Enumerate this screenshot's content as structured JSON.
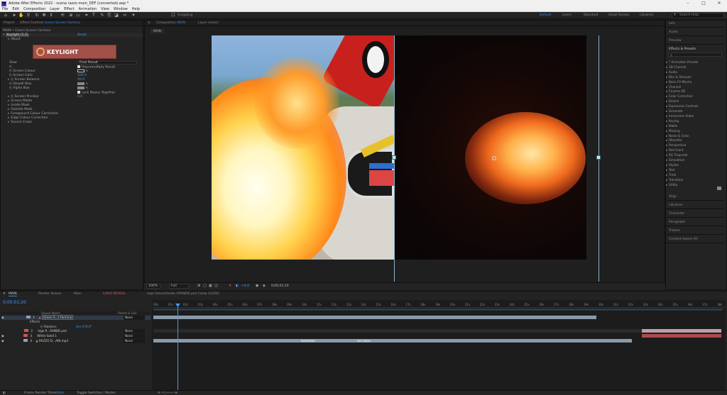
{
  "window": {
    "title": "Adobe After Effects 2022 - scena razzo main_DEF (converted).aep *",
    "app_badge": "Ae"
  },
  "window_controls": {
    "minimize": "–",
    "maximize": "□",
    "close": "✕"
  },
  "menu": [
    "File",
    "Edit",
    "Composition",
    "Layer",
    "Effect",
    "Animation",
    "View",
    "Window",
    "Help"
  ],
  "toolbar": {
    "snapping": "Snapping",
    "workspaces": [
      "Default",
      "Learn",
      "Standard",
      "Small Screen",
      "Libraries"
    ],
    "active_workspace": "Default",
    "search_placeholder": "Search Help",
    "tools": [
      "home-icon",
      "selection-icon",
      "hand-icon",
      "zoom-icon",
      "orbit-icon",
      "pan-icon",
      "dolly-icon",
      "rotate-icon",
      "anchor-icon",
      "pen-icon",
      "type-icon",
      "brush-icon",
      "clone-icon",
      "eraser-icon",
      "roto-icon",
      "puppet-icon"
    ]
  },
  "left_panel": {
    "tabs": [
      "Project",
      "Effect Controls Green Screen Farmina"
    ],
    "tab_effect_controls": "Effect Controls",
    "tab_layer_name": "Green Screen Farmina",
    "path": "MAIN • Green Screen Farmina",
    "effect_name": "Keylight (1.2)",
    "reset": "Reset",
    "about": "About",
    "logo_text": "KEYLIGHT",
    "rows": [
      {
        "label": "View",
        "value": "Final Result"
      },
      {
        "label": "",
        "value": "Unpremultiply Result"
      },
      {
        "label": "Screen Colour",
        "value": ""
      },
      {
        "label": "Screen Gain",
        "value": "100.0"
      },
      {
        "label": "Screen Balance",
        "value": "50.0"
      },
      {
        "label": "Despill Bias",
        "value": ""
      },
      {
        "label": "Alpha Bias",
        "value": ""
      },
      {
        "label": "",
        "value": "Lock Biases Together"
      },
      {
        "label": "Screen Pre-blur",
        "value": "0.0"
      },
      {
        "label": "Screen Matte",
        "value": ""
      },
      {
        "label": "Inside Mask",
        "value": ""
      },
      {
        "label": "Outside Mask",
        "value": ""
      },
      {
        "label": "Foreground Colour Correction",
        "value": ""
      },
      {
        "label": "Edge Colour Correction",
        "value": ""
      },
      {
        "label": "Source Crops",
        "value": ""
      }
    ]
  },
  "viewer": {
    "comp_tab": "Composition MAIN",
    "comp_tab_label": "Composition",
    "comp_tab_name": "MAIN",
    "layer_tab": "Layer (none)",
    "breadcrumb": "MAIN",
    "zoom": "100%",
    "resolution": "Full",
    "exposure": "+0.0",
    "timecode": "0;00;01;20"
  },
  "right_panel": {
    "sections_top": [
      "Info",
      "Audio",
      "Preview"
    ],
    "effects_title": "Effects & Presets",
    "effects_search": "",
    "effects": [
      "* Animation Presets",
      "3D Channel",
      "Audio",
      "Blur & Sharpen",
      "Boris FX Mocha",
      "Channel",
      "Cinema 4D",
      "Color Correction",
      "Distort",
      "Expression Controls",
      "Generate",
      "Immersive Video",
      "Keying",
      "Matte",
      "Missing",
      "Noise & Grain",
      "Obsolete",
      "Perspective",
      "Red Giant",
      "RG Trapcode",
      "Simulation",
      "Stylize",
      "Text",
      "Time",
      "Transition",
      "Utility"
    ],
    "sections_bottom": [
      "Align",
      "Libraries",
      "Character",
      "Paragraph",
      "Tracker",
      "Content-Aware Fill"
    ]
  },
  "timeline": {
    "tabs": [
      "MAIN",
      "Render Queue",
      "Main",
      "LOGO REVEAL",
      "logo futuro/studio GRANDE.psd Comp 1LOGO"
    ],
    "timecode": "0;00;01;20",
    "col_headers": {
      "source": "Source Name",
      "parent": "Parent & Link"
    },
    "layers": [
      {
        "num": "1",
        "name": "Green S...t Farmina",
        "parent": "None"
      },
      {
        "num": "",
        "name": "Effects",
        "parent": ""
      },
      {
        "num": "",
        "name": "Rotation",
        "value": "0x+270.0°",
        "parent": ""
      },
      {
        "num": "2",
        "name": "logo fl...RANDE.psd",
        "parent": "None"
      },
      {
        "num": "3",
        "name": "White Solid 1",
        "parent": "None"
      },
      {
        "num": "4",
        "name": "RAZZO D...AIN.mp4",
        "parent": "None"
      }
    ],
    "ruler": [
      "00s",
      "01s",
      "02s",
      "03s",
      "04s",
      "05s",
      "06s",
      "07s",
      "08s",
      "09s",
      "10s",
      "11s",
      "12s",
      "13s",
      "14s",
      "15s",
      "16s",
      "17s",
      "18s",
      "19s",
      "20s",
      "21s",
      "22s",
      "23s",
      "24s",
      "25s",
      "26s",
      "27s",
      "28s",
      "29s",
      "30s",
      "31s",
      "32s",
      "33s",
      "34s",
      "35s",
      "36s",
      "37s",
      "38s"
    ],
    "markers": [
      "PARTENZA",
      "SECONDA"
    ],
    "status_frame": "Frame Render Time:",
    "status_ms": "63ms",
    "toggle": "Toggle Switches / Modes"
  }
}
